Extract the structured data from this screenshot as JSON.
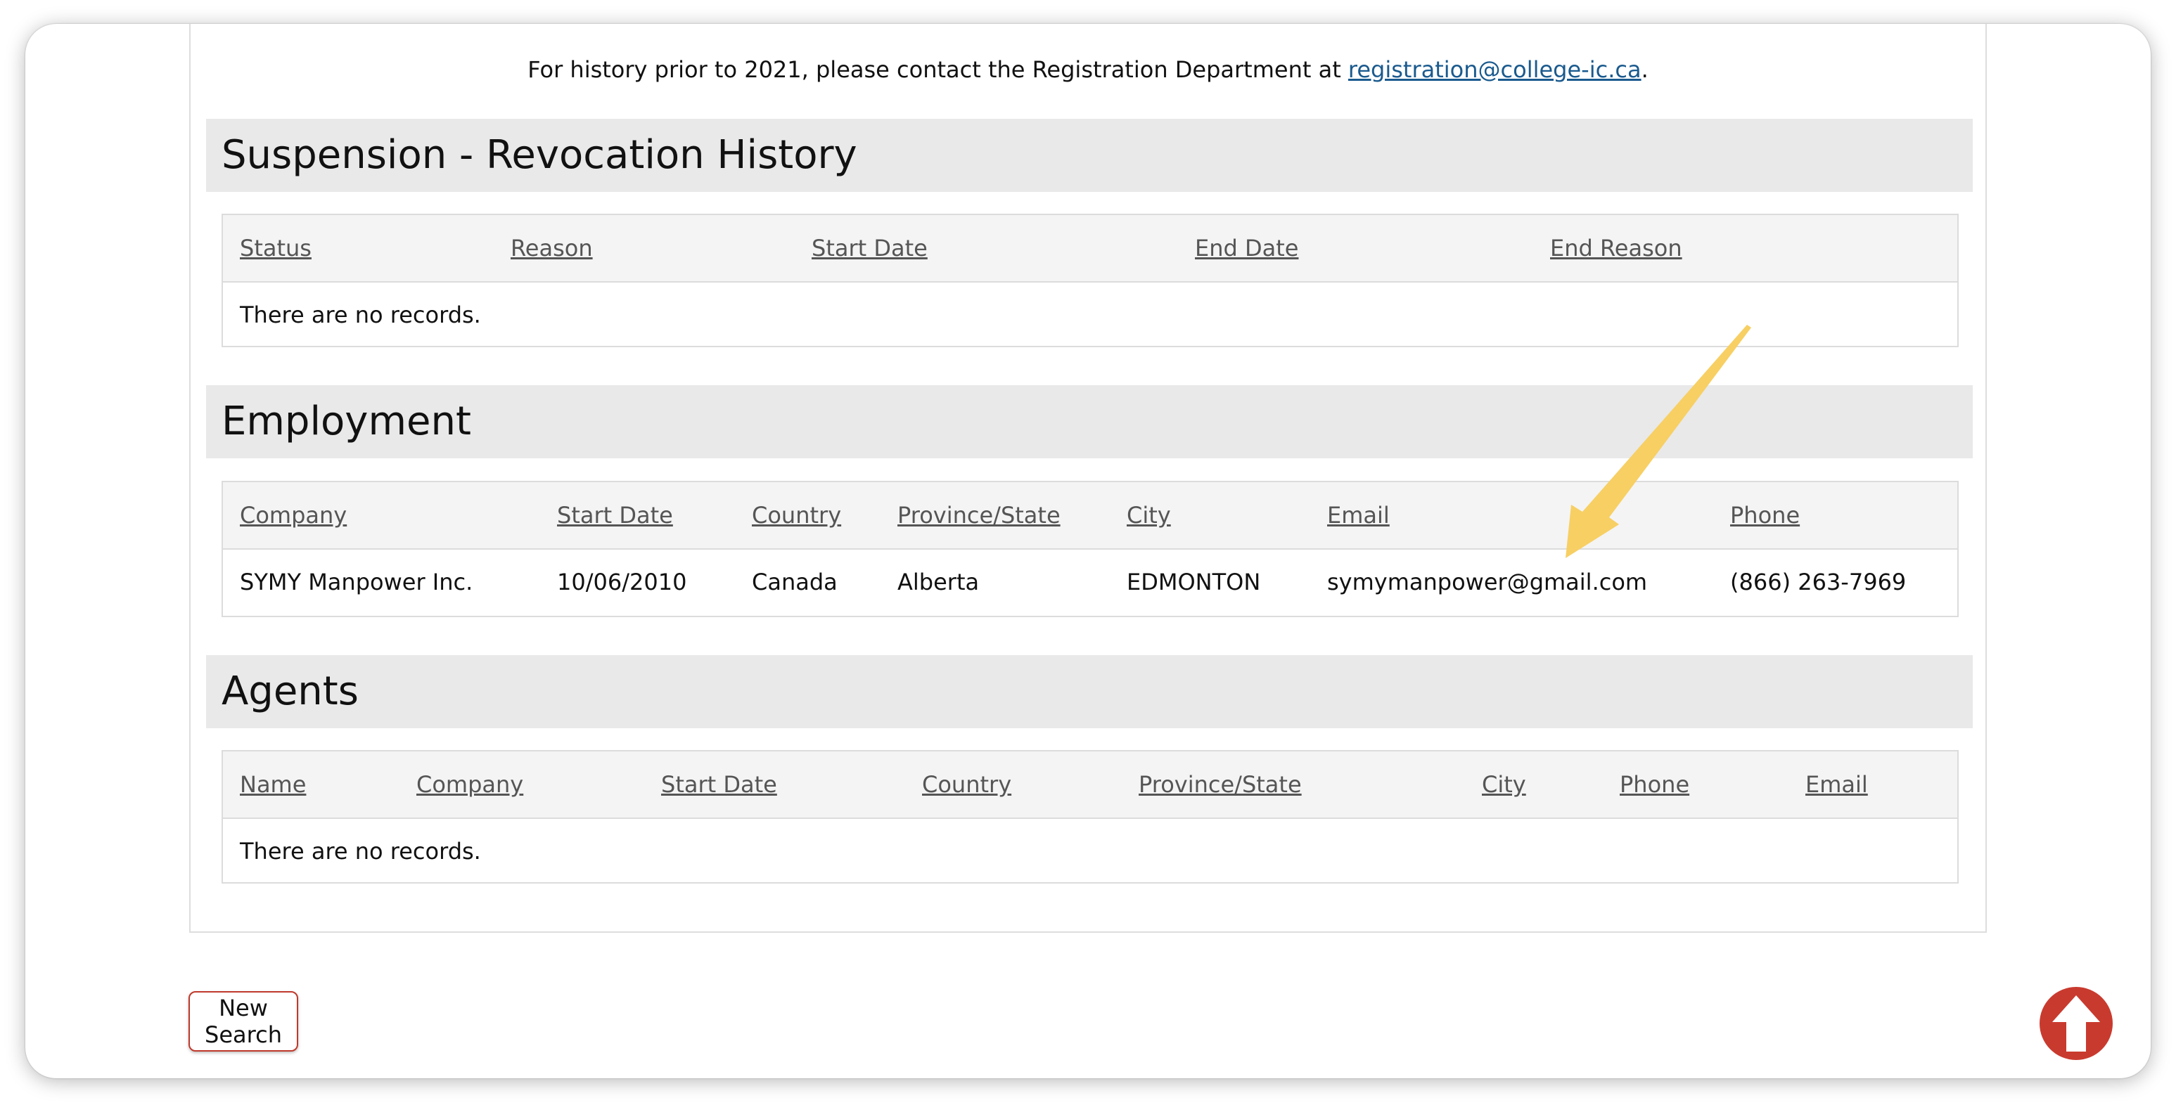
{
  "notice": {
    "text_before": "For history prior to 2021, please contact the Registration Department at ",
    "link": "registration@college-ic.ca",
    "text_after": "."
  },
  "suspension": {
    "title": "Suspension - Revocation History",
    "columns": [
      "Status",
      "Reason",
      "Start Date",
      "End Date",
      "End Reason"
    ],
    "empty": "There are no records."
  },
  "employment": {
    "title": "Employment",
    "columns": [
      "Company",
      "Start Date",
      "Country",
      "Province/State",
      "City",
      "Email",
      "Phone"
    ],
    "rows": [
      [
        "SYMY Manpower Inc.",
        "10/06/2010",
        "Canada",
        "Alberta",
        "EDMONTON",
        "symymanpower@gmail.com",
        "(866) 263-7969"
      ]
    ]
  },
  "agents": {
    "title": "Agents",
    "columns": [
      "Name",
      "Company",
      "Start Date",
      "Country",
      "Province/State",
      "City",
      "Phone",
      "Email"
    ],
    "empty": "There are no records."
  },
  "buttons": {
    "new_search": "New Search",
    "scroll_top_icon": "arrow-up-icon"
  },
  "colors": {
    "section_header_bg": "#e9e9e9",
    "grid_header_bg": "#f4f4f4",
    "accent_red": "#c93a2e",
    "annotation_arrow": "#f7cf63",
    "link": "#1a5a8e"
  }
}
